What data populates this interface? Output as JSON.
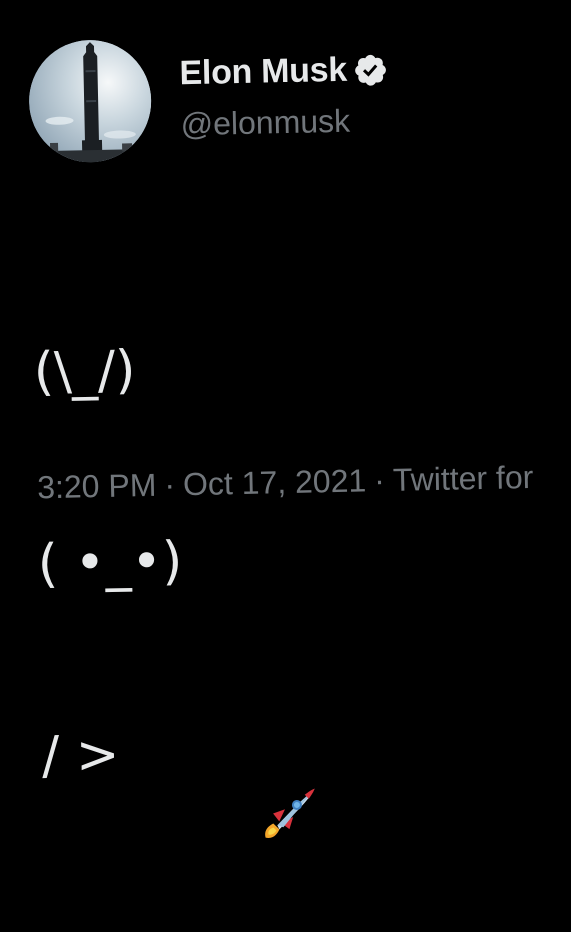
{
  "author": {
    "display_name": "Elon Musk",
    "handle": "@elonmusk",
    "verified": true,
    "avatar_icon": "starship-avatar-icon"
  },
  "tweet": {
    "lines": [
      "(\\_/)",
      "( •_•)",
      "/ >"
    ],
    "emoji": "rocket-icon"
  },
  "meta": {
    "time": "3:20 PM",
    "date": "Oct 17, 2021",
    "source": "Twitter for",
    "separator": "·"
  },
  "colors": {
    "background": "#000000",
    "text": "#e7e9ea",
    "secondary": "#71767b"
  }
}
